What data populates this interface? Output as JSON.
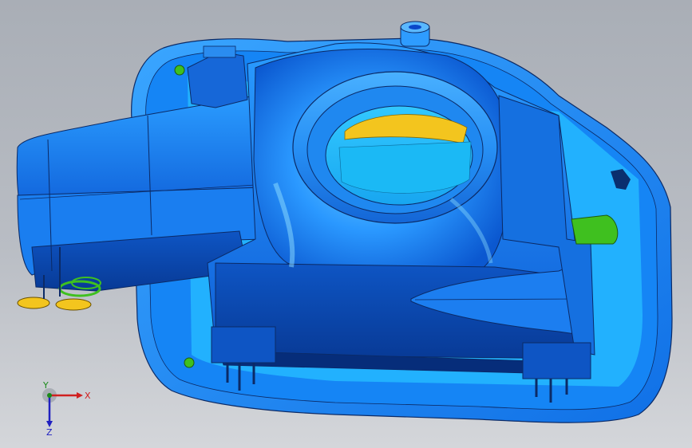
{
  "viewport": {
    "background_top": "#a9aeb6",
    "background_bottom": "#d4d6da",
    "model_color": "#1f8fff",
    "model_dark": "#0a47c9",
    "model_edge": "#0b2a66",
    "accent_yellow": "#f3c51e",
    "accent_green": "#3fc01f"
  },
  "triad": {
    "x_label": "X",
    "y_label": "Y",
    "z_label": "Z"
  }
}
